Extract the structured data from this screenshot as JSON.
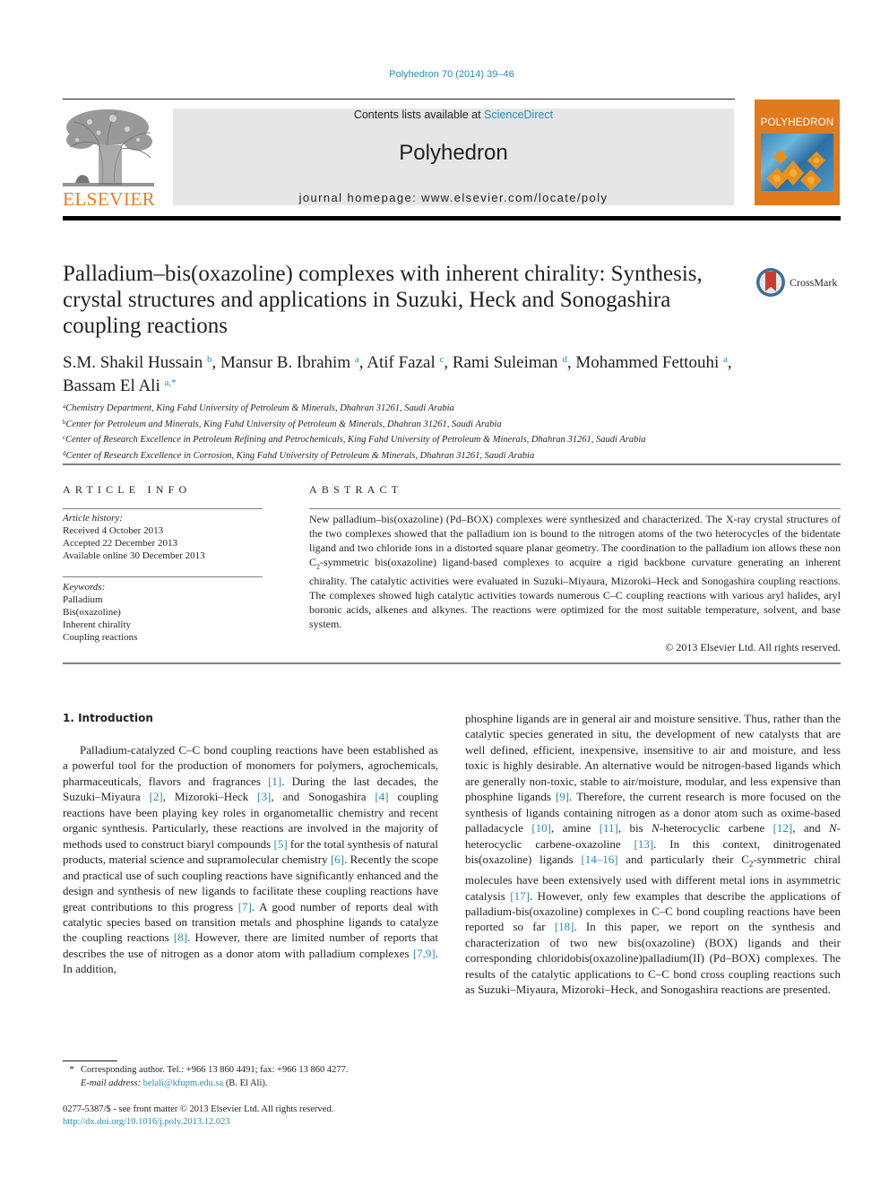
{
  "header": {
    "citation": "Polyhedron 70 (2014) 39–46",
    "contents_prefix": "Contents lists available at ",
    "contents_link": "ScienceDirect",
    "journal_name": "Polyhedron",
    "homepage": "journal homepage: www.elsevier.com/locate/poly",
    "publisher_logo_text": "ELSEVIER",
    "cover_title": "POLYHEDRON",
    "brand_orange": "#f47920",
    "link_color": "#2a8cb8"
  },
  "article": {
    "title": "Palladium–bis(oxazoline) complexes with inherent chirality: Synthesis, crystal structures and applications in Suzuki, Heck and Sonogashira coupling reactions",
    "crossmark_label": "CrossMark",
    "authors": [
      {
        "name": "S.M. Shakil Hussain",
        "aff": "b"
      },
      {
        "name": "Mansur B. Ibrahim",
        "aff": "a"
      },
      {
        "name": "Atif Fazal",
        "aff": "c"
      },
      {
        "name": "Rami Suleiman",
        "aff": "d"
      },
      {
        "name": "Mohammed Fettouhi",
        "aff": "a"
      },
      {
        "name": "Bassam El Ali",
        "aff": "a,*"
      }
    ],
    "affiliations": [
      {
        "key": "a",
        "text": "Chemistry Department, King Fahd University of Petroleum & Minerals, Dhahran 31261, Saudi Arabia"
      },
      {
        "key": "b",
        "text": "Center for Petroleum and Minerals, King Fahd University of Petroleum & Minerals, Dhahran 31261, Saudi Arabia"
      },
      {
        "key": "c",
        "text": "Center of Research Excellence in Petroleum Refining and Petrochemicals, King Fahd University of Petroleum & Minerals, Dhahran 31261, Saudi Arabia"
      },
      {
        "key": "d",
        "text": "Center of Research Excellence in Corrosion, King Fahd University of Petroleum & Minerals, Dhahran 31261, Saudi Arabia"
      }
    ]
  },
  "article_info": {
    "heading": "ARTICLE INFO",
    "history_label": "Article history:",
    "received": "Received 4 October 2013",
    "accepted": "Accepted 22 December 2013",
    "online": "Available online 30 December 2013",
    "keywords_label": "Keywords:",
    "keywords": [
      "Palladium",
      "Bis(oxazoline)",
      "Inherent chirality",
      "Coupling reactions"
    ]
  },
  "abstract": {
    "heading": "ABSTRACT",
    "text_1": "New palladium–bis(oxazoline) (Pd–BOX) complexes were synthesized and characterized. The X-ray crystal structures of the two complexes showed that the palladium ion is bound to the nitrogen atoms of the two heterocycles of the bidentate ligand and two chloride ions in a distorted square planar geometry. The coordination to the palladium ion allows these non C",
    "sub": "2",
    "text_2": "-symmetric bis(oxazoline) ligand-based complexes to acquire a rigid backbone curvature generating an inherent chirality. The catalytic activities were evaluated in Suzuki–Miyaura, Mizoroki–Heck and Sonogashira coupling reactions. The complexes showed high catalytic activities towards numerous C–C coupling reactions with various aryl halides, aryl boronic acids, alkenes and alkynes. The reactions were optimized for the most suitable temperature, solvent, and base system.",
    "copyright": "© 2013 Elsevier Ltd. All rights reserved."
  },
  "introduction": {
    "heading": "1. Introduction",
    "left": [
      "Palladium-catalyzed C–C bond coupling reactions have been established as a powerful tool for the production of monomers for polymers, agrochemicals, pharmaceuticals, flavors and fragrances ",
      "[1]",
      ". During the last decades, the Suzuki–Miyaura ",
      "[2]",
      ", Mizoroki–Heck ",
      "[3]",
      ", and Sonogashira ",
      "[4]",
      " coupling reactions have been playing key roles in organometallic chemistry and recent organic synthesis. Particularly, these reactions are involved in the majority of methods used to construct biaryl compounds ",
      "[5]",
      " for the total synthesis of natural products, material science and supramolecular chemistry ",
      "[6]",
      ". Recently the scope and practical use of such coupling reactions have significantly enhanced and the design and synthesis of new ligands to facilitate these coupling reactions have great contributions to this progress ",
      "[7]",
      ". A good number of reports deal with catalytic species based on transition metals and phosphine ligands to catalyze the coupling reactions ",
      "[8]",
      ". However, there are limited number of reports that describes the use of nitrogen as a donor atom with palladium complexes ",
      "[7,9]",
      ". In addition,"
    ],
    "right": [
      "phosphine ligands are in general air and moisture sensitive. Thus, rather than the catalytic species generated in situ, the development of new catalysts that are well defined, efficient, inexpensive, insensitive to air and moisture, and less toxic is highly desirable. An alternative would be nitrogen-based ligands which are generally non-toxic, stable to air/moisture, modular, and less expensive than phosphine ligands ",
      "[9]",
      ". Therefore, the current research is more focused on the synthesis of ligands containing nitrogen as a donor atom such as oxime-based palladacycle ",
      "[10]",
      ", amine ",
      "[11]",
      ", bis ",
      "N",
      "-heterocyclic carbene ",
      "[12]",
      ", and ",
      "N",
      "-heterocyclic carbene-oxazoline ",
      "[13]",
      ". In this context, dinitrogenated bis(oxazoline) ligands ",
      "[14–16]",
      " and particularly their C",
      "2",
      "-symmetric chiral molecules have been extensively used with different metal ions in asymmetric catalysis ",
      "[17]",
      ". However, only few examples that describe the applications of palladium-bis(oxazoline) complexes in C–C bond coupling reactions have been reported so far ",
      "[18]",
      ". In this paper, we report on the synthesis and characterization of two new bis(oxazoline) (BOX) ligands and their corresponding chloridobis(oxazoline)palladium(II) (Pd–BOX) complexes. The results of the catalytic applications to C–C bond cross coupling reactions such as Suzuki–Miyaura, Mizoroki–Heck, and Sonogashira reactions are presented."
    ]
  },
  "footnotes": {
    "star": "*",
    "corresponding": "Corresponding author. Tel.: +966 13 860 4491; fax: +966 13 860 4277.",
    "email_label": "E-mail address:",
    "email": "belali@kfupm.edu.sa",
    "email_suffix": " (B. El Ali).",
    "issn_line": "0277-5387/$ - see front matter © 2013 Elsevier Ltd. All rights reserved.",
    "doi": "http://dx.doi.org/10.1016/j.poly.2013.12.023"
  }
}
